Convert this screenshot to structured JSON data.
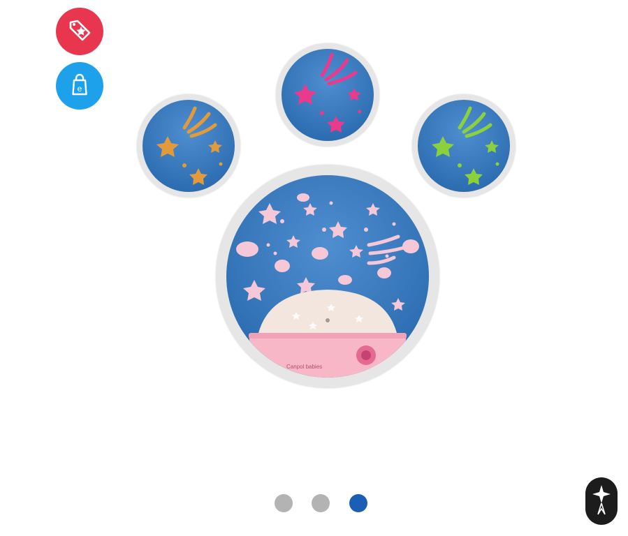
{
  "actions": {
    "deal_button": {
      "icon": "tag-star-icon",
      "color": "#e8364f"
    },
    "shop_button": {
      "icon": "shopping-bag-e-icon",
      "color": "#1ca1ea"
    }
  },
  "gallery": {
    "images": [
      {
        "icon": "star-projection-orange",
        "star_color": "#e29a3a"
      },
      {
        "icon": "star-projection-pink",
        "star_color": "#e93a8c"
      },
      {
        "icon": "star-projection-green",
        "star_color": "#8ad13b"
      },
      {
        "icon": "star-projector-lamp",
        "lamp_label": "Canpol babies",
        "star_color": "#f6c7d6"
      }
    ],
    "pagination": {
      "count": 3,
      "active_index": 2,
      "active_color": "#1a5fb4",
      "inactive_color": "#b3b3b3"
    }
  },
  "assistant": {
    "icon": "assistant-logo-icon",
    "color": "#1c1c1c"
  }
}
